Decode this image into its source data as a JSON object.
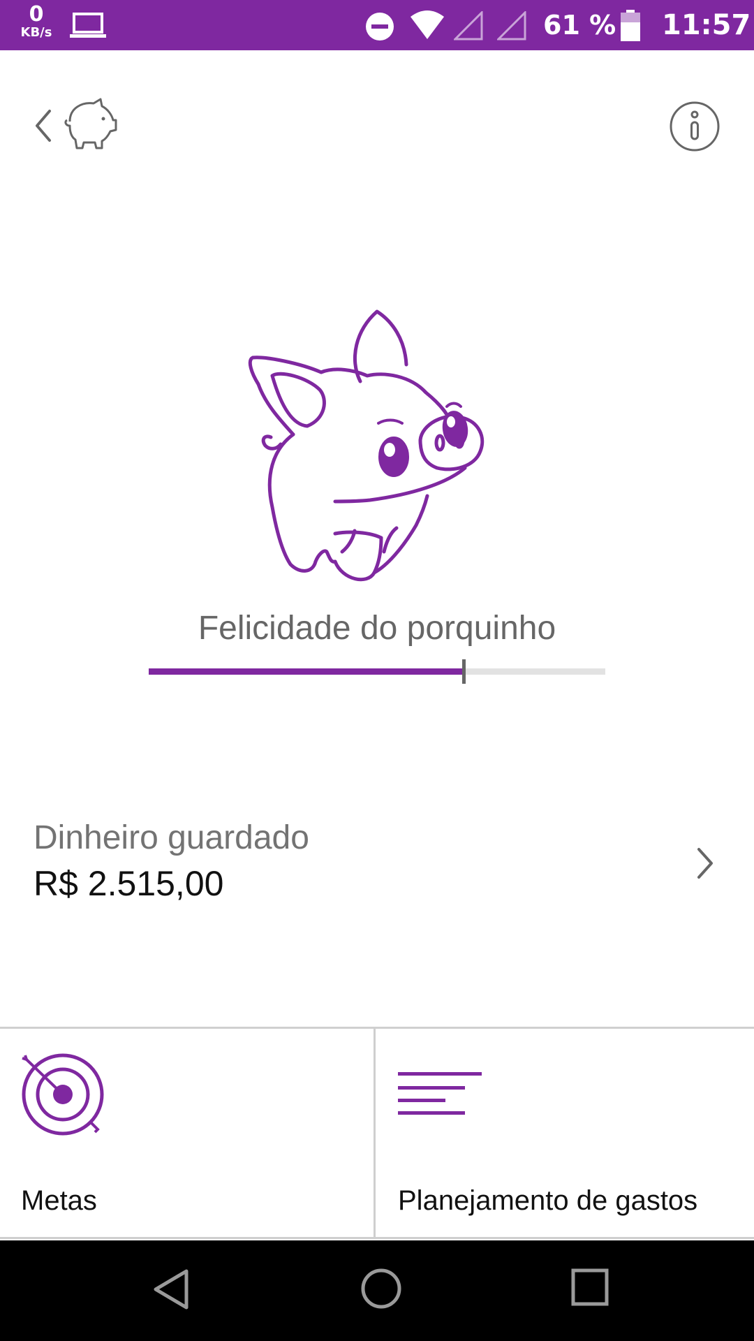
{
  "status_bar": {
    "net_speed_value": "0",
    "net_speed_unit": "KB/s",
    "battery_percent": "61 %",
    "time": "11:57",
    "icons": [
      "laptop-icon",
      "do-not-disturb-icon",
      "wifi-icon",
      "signal-icon",
      "signal-icon",
      "battery-icon"
    ]
  },
  "app_bar": {
    "icons": [
      "back-chevron-icon",
      "piggy-bank-icon",
      "info-icon"
    ]
  },
  "pig": {
    "icon": "happy-pig-illustration",
    "happiness_label": "Felicidade do porquinho",
    "happiness_level": 0.69
  },
  "savings": {
    "label": "Dinheiro guardado",
    "value": "R$ 2.515,00",
    "icon": "chevron-right-icon"
  },
  "shortcuts": [
    {
      "label": "Metas",
      "icon": "target-icon"
    },
    {
      "label": "Planejamento de gastos",
      "icon": "lines-list-icon"
    }
  ],
  "nav_bar": {
    "icons": [
      "nav-back-icon",
      "nav-home-icon",
      "nav-recents-icon"
    ]
  },
  "colors": {
    "brand_purple": "#7f28a0",
    "text_gray": "#666666",
    "track_gray": "#e2e2e2"
  }
}
